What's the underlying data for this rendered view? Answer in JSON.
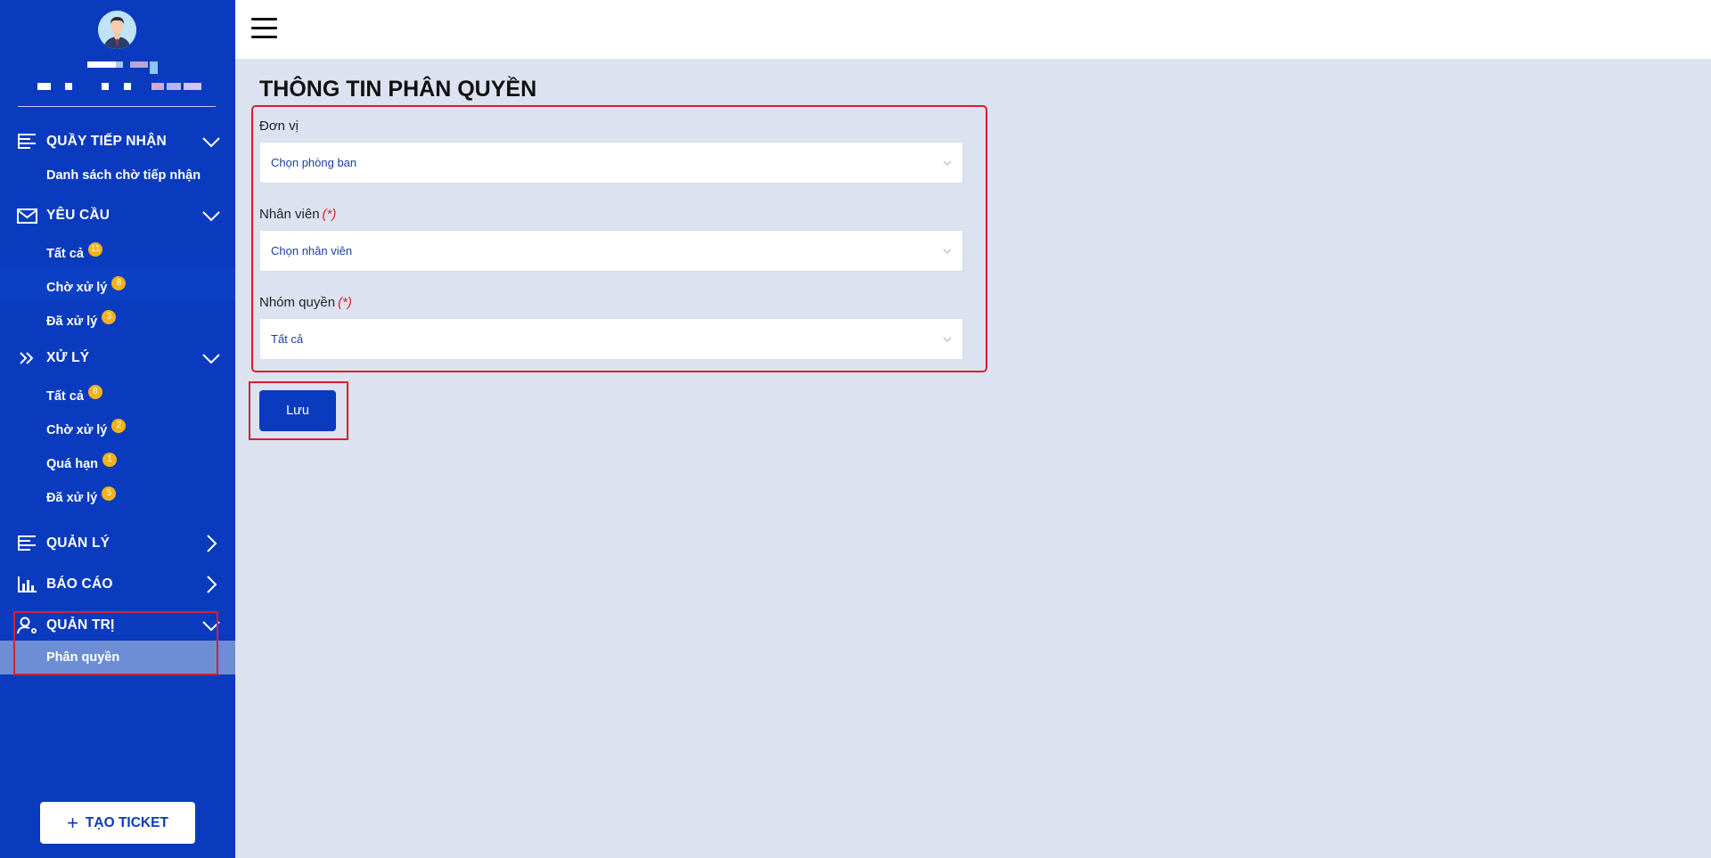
{
  "sidebar": {
    "sections": [
      {
        "label": "QUẦY TIẾP NHẬN",
        "icon": "list-icon",
        "expanded": true,
        "items": [
          {
            "label": "Danh sách chờ tiếp nhận"
          }
        ]
      },
      {
        "label": "YÊU CẦU",
        "icon": "envelope-icon",
        "expanded": true,
        "items": [
          {
            "label": "Tất cả",
            "badge": "11"
          },
          {
            "label": "Chờ xử lý",
            "badge": "8"
          },
          {
            "label": "Đã xử lý",
            "badge": "3"
          }
        ]
      },
      {
        "label": "XỬ LÝ",
        "icon": "double-chevron-icon",
        "expanded": true,
        "items": [
          {
            "label": "Tất cả",
            "badge": "8"
          },
          {
            "label": "Chờ xử lý",
            "badge": "2"
          },
          {
            "label": "Quá hạn",
            "badge": "1"
          },
          {
            "label": "Đã xử lý",
            "badge": "5"
          }
        ]
      },
      {
        "label": "QUẢN LÝ",
        "icon": "list-icon",
        "expanded": false,
        "items": []
      },
      {
        "label": "BÁO CÁO",
        "icon": "bar-chart-icon",
        "expanded": false,
        "items": []
      },
      {
        "label": "QUẢN TRỊ",
        "icon": "user-gear-icon",
        "expanded": true,
        "items": [
          {
            "label": "Phân quyền",
            "active": true
          }
        ]
      }
    ],
    "create_button": {
      "label": "TẠO TICKET",
      "icon": "plus-icon"
    }
  },
  "topbar": {
    "menu_icon": "hamburger-icon"
  },
  "main": {
    "title": "THÔNG TIN PHÂN QUYỀN",
    "fields": [
      {
        "label": "Đơn vị",
        "required": false,
        "value": "Chọn phòng ban"
      },
      {
        "label": "Nhân viên",
        "required": true,
        "required_mark": "(*)",
        "value": "Chọn nhân viên"
      },
      {
        "label": "Nhóm quyền",
        "required": true,
        "required_mark": "(*)",
        "value": "Tất cả"
      }
    ],
    "save_label": "Lưu"
  },
  "colors": {
    "sidebar_bg": "#0a3bbf",
    "content_bg": "#dde2f0",
    "badge": "#f5b31a",
    "highlight": "#d6202d",
    "active_item": "#6d8ed4"
  }
}
